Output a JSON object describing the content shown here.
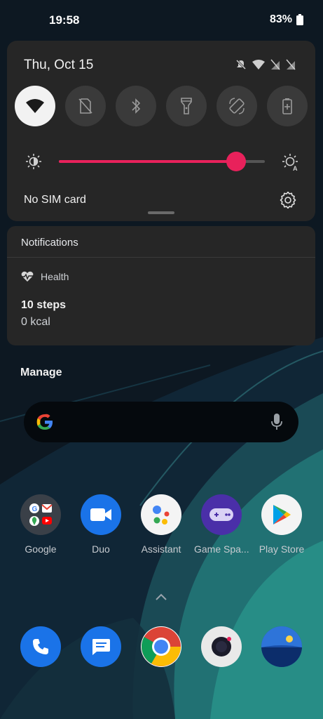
{
  "status_bar": {
    "time": "19:58",
    "battery": "83%"
  },
  "quick_settings": {
    "date": "Thu, Oct 15",
    "tiles": [
      {
        "name": "wifi",
        "icon": "wifi-icon",
        "active": true
      },
      {
        "name": "mobile-data",
        "icon": "no-sim-icon",
        "active": false
      },
      {
        "name": "bluetooth",
        "icon": "bluetooth-icon",
        "active": false
      },
      {
        "name": "flashlight",
        "icon": "flashlight-icon",
        "active": false
      },
      {
        "name": "auto-rotate",
        "icon": "rotate-icon",
        "active": false
      },
      {
        "name": "battery-saver",
        "icon": "battery-saver-icon",
        "active": false
      }
    ],
    "brightness_level": 0.86,
    "sim_status": "No SIM card",
    "accent_color": "#e8215b"
  },
  "notifications": {
    "header": "Notifications",
    "items": [
      {
        "app": "Health",
        "title": "10 steps",
        "text": "0 kcal"
      }
    ]
  },
  "manage_label": "Manage",
  "search": {
    "placeholder": ""
  },
  "apps": [
    {
      "label": "Google",
      "icon": "google-folder-icon"
    },
    {
      "label": "Duo",
      "icon": "duo-icon"
    },
    {
      "label": "Assistant",
      "icon": "assistant-icon"
    },
    {
      "label": "Game Spa...",
      "icon": "game-space-icon"
    },
    {
      "label": "Play Store",
      "icon": "play-store-icon"
    }
  ],
  "dock": [
    {
      "icon": "phone-icon"
    },
    {
      "icon": "messages-icon"
    },
    {
      "icon": "chrome-icon"
    },
    {
      "icon": "camera-icon"
    },
    {
      "icon": "gallery-icon"
    }
  ]
}
